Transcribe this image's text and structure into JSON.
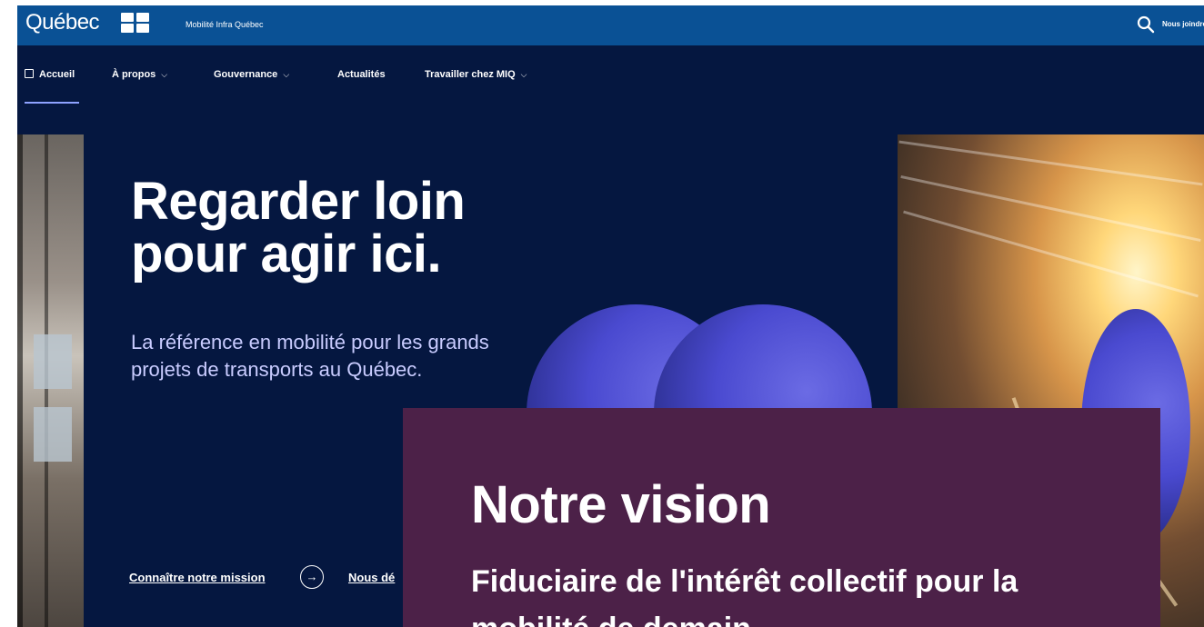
{
  "header": {
    "logo_text": "Québec",
    "org_name": "Mobilité Infra Québec",
    "contact_label": "Nous joindre"
  },
  "nav": {
    "items": [
      {
        "label": "Accueil",
        "icon": "home-icon",
        "dropdown": false,
        "active": true
      },
      {
        "label": "À propos",
        "dropdown": true
      },
      {
        "label": "Gouvernance",
        "dropdown": true
      },
      {
        "label": "Actualités",
        "dropdown": false
      },
      {
        "label": "Travailler chez MIQ",
        "dropdown": true
      }
    ]
  },
  "hero": {
    "title_line1": "Regarder loin",
    "title_line2": "pour agir ici.",
    "subtitle": "La référence en mobilité pour les grands projets de transports au Québec.",
    "cta_mission": "Connaître notre mission",
    "cta_second": "Nous dé"
  },
  "vision": {
    "title": "Notre vision",
    "text": "Fiduciaire de l'intérêt collectif pour la mobilité de demain"
  },
  "colors": {
    "gov_blue": "#0a5195",
    "navy": "#051740",
    "vision_purple": "#4c2148",
    "accent_lavender": "#c9ccff"
  }
}
